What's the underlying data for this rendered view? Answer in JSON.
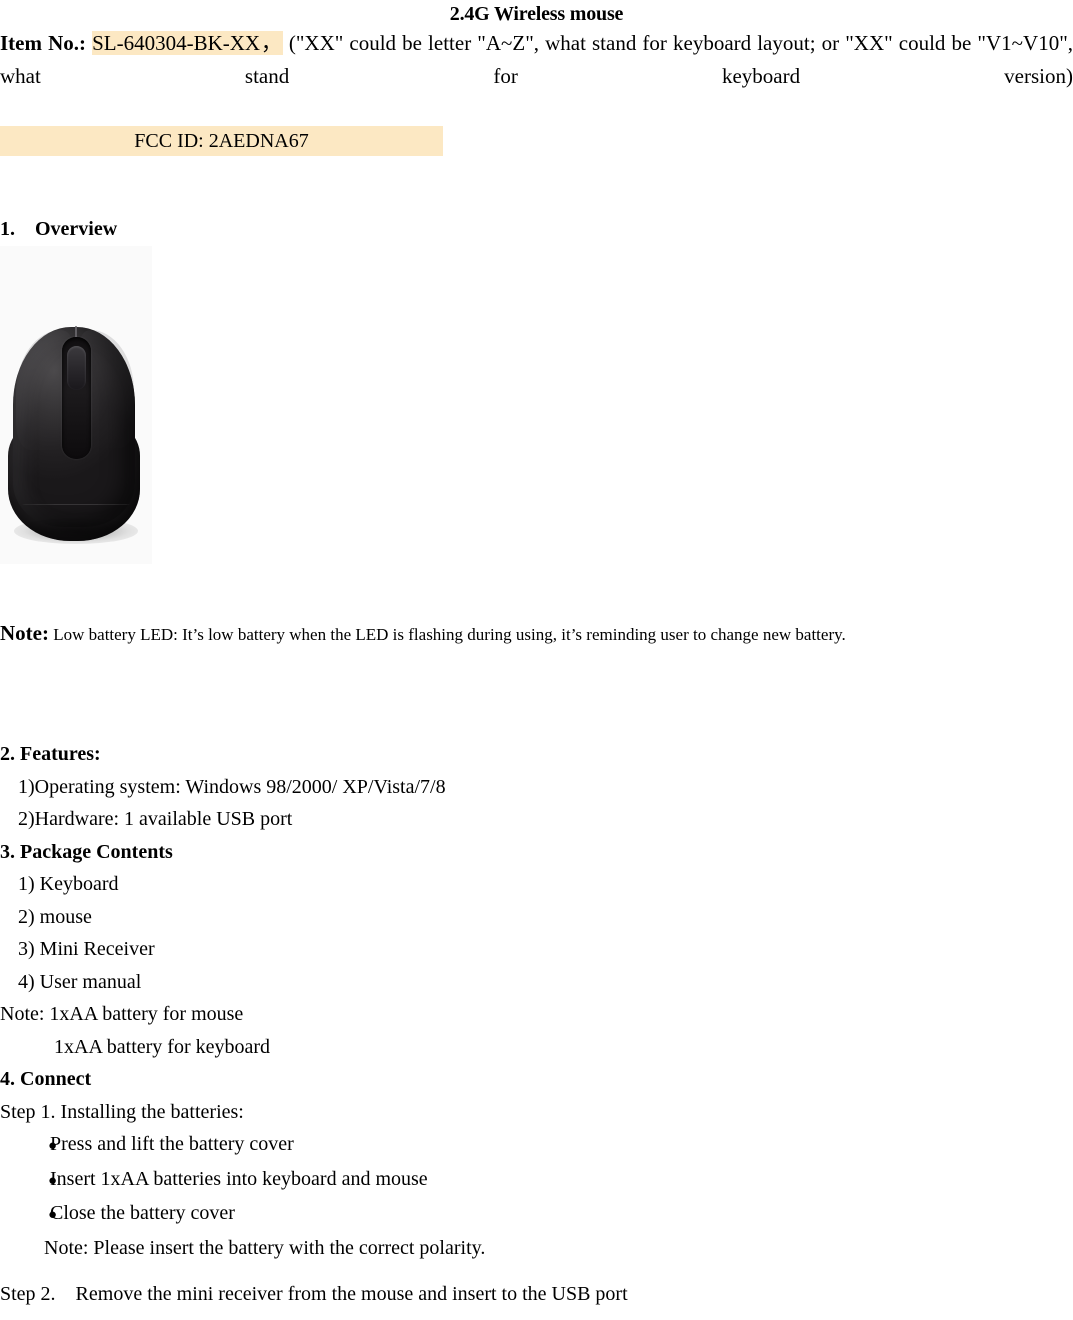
{
  "document": {
    "title": "2.4G Wireless mouse",
    "item_no": {
      "label": "Item No.:",
      "highlighted_value": "SL-640304-BK-XX，",
      "description": "(\"XX\" could be letter \"A~Z\", what stand for keyboard layout; or \"XX\" could be \"V1~V10\", what stand for keyboard version)"
    },
    "fcc_id": "FCC ID: 2AEDNA67",
    "highlight_color": "#fce8c3"
  },
  "sections": {
    "overview": {
      "heading": "1.    Overview",
      "image_alt": "black wireless mouse top view",
      "note_lead": "Note:",
      "note_text": "Low battery LED: It’s low battery when the LED is flashing during using, it’s reminding user to change new battery."
    },
    "features": {
      "heading": "2. Features:",
      "items": [
        "1)Operating system: Windows 98/2000/ XP/Vista/7/8",
        "2)Hardware: 1 available USB port"
      ]
    },
    "package_contents": {
      "heading": "3. Package Contents",
      "items": [
        "1) Keyboard",
        "2) mouse",
        "3) Mini Receiver",
        "4) User manual"
      ],
      "note_first": "Note: 1xAA battery for mouse",
      "note_second": "1xAA battery for keyboard"
    },
    "connect": {
      "heading": "4. Connect",
      "step1_label": "Step 1. Installing the batteries:",
      "bullet_glyph": "●",
      "bullets": [
        "Press and lift the battery cover",
        "Insert 1xAA batteries into keyboard and mouse",
        "Close the battery cover"
      ],
      "step1_note": "Note: Please insert the battery with the correct polarity.",
      "step2_label": "Step 2.    Remove the mini receiver from the mouse and insert to the USB port"
    }
  }
}
